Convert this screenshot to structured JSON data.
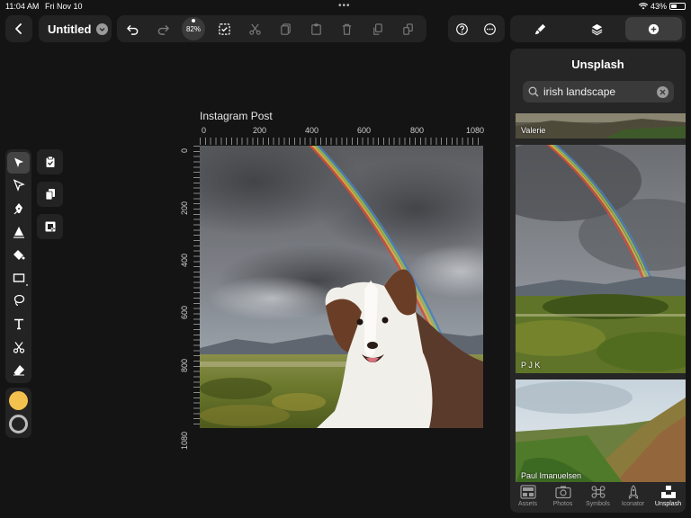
{
  "status": {
    "time": "11:04 AM",
    "date": "Fri Nov 10",
    "battery": "43%",
    "battery_level": 0.43
  },
  "document": {
    "title": "Untitled"
  },
  "zoom": {
    "value": "82%"
  },
  "panel_tabs": [
    "styles-brush",
    "layers",
    "add"
  ],
  "tools": [
    "select",
    "direct-select",
    "pen",
    "vector-brush",
    "paint-bucket",
    "rectangle",
    "lasso",
    "text",
    "scissors",
    "eraser"
  ],
  "colors": {
    "fill": "#f2c14e",
    "stroke": "#bcbcbc"
  },
  "artboard": {
    "name": "Instagram Post",
    "h_ruler": [
      "0",
      "200",
      "400",
      "600",
      "800",
      "1080"
    ],
    "v_ruler": [
      "0",
      "200",
      "400",
      "600",
      "800",
      "1080"
    ]
  },
  "unsplash": {
    "title": "Unsplash",
    "search_value": "irish landscape",
    "results": [
      {
        "credit": "Valerie"
      },
      {
        "credit": "P J K"
      },
      {
        "credit": "Paul Imanuelsen"
      }
    ]
  },
  "tabbar": [
    {
      "label": "Assets",
      "icon": "assets-icon"
    },
    {
      "label": "Photos",
      "icon": "camera-icon"
    },
    {
      "label": "Symbols",
      "icon": "command-icon"
    },
    {
      "label": "Iconator",
      "icon": "rocket-icon"
    },
    {
      "label": "Unsplash",
      "icon": "unsplash-icon"
    }
  ]
}
